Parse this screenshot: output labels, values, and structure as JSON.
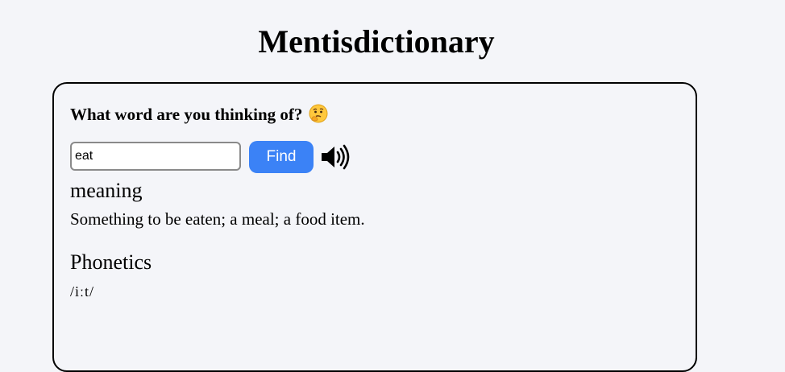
{
  "app": {
    "title": "Mentisdictionary"
  },
  "search": {
    "prompt": "What word are you thinking of?",
    "emoji_icon": "thinking-face-icon",
    "value": "eat",
    "button_label": "Find",
    "audio_icon": "speaker-volume-icon"
  },
  "result": {
    "meaning_heading": "meaning",
    "meaning_text": "Something to be eaten; a meal; a food item.",
    "phonetics_heading": "Phonetics",
    "phonetics_text": "/iːt/"
  },
  "colors": {
    "background": "#f4f5f9",
    "accent": "#3b82f6",
    "card_border": "#000000"
  }
}
